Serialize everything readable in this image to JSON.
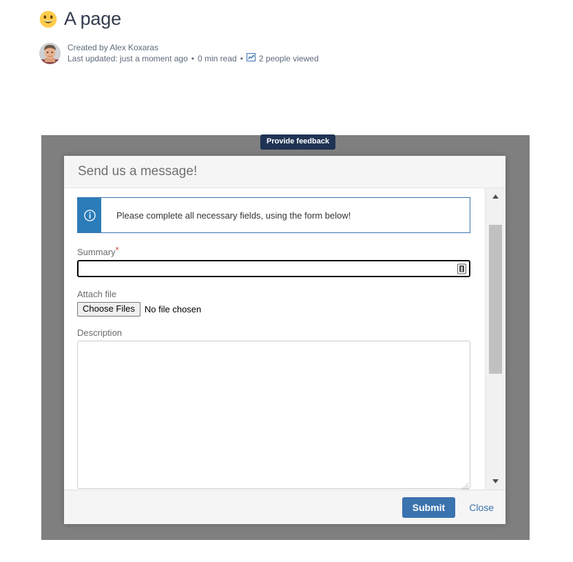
{
  "page": {
    "emoji": "grinning-face",
    "title": "A page",
    "author_line": "Created by Alex Koxaras",
    "meta_updated": "Last updated: just a moment ago",
    "meta_sep1": "•",
    "meta_read": "0 min read",
    "meta_sep2": "•",
    "meta_views": "2 people viewed",
    "views_icon": "line-chart-icon",
    "avatar_alt": "avatar"
  },
  "tooltip": {
    "text": "Provide feedback",
    "bg": "#1f3354"
  },
  "dialog": {
    "title": "Send us a message!",
    "info": {
      "icon": "info-circle-icon",
      "message": "Please complete all necessary fields, using the form below!",
      "accent": "#2b7cb9",
      "border": "#3b73af"
    },
    "fields": {
      "summary": {
        "label": "Summary",
        "required_mark": "*",
        "value": "",
        "placeholder": "",
        "inline_icon": "password-manager-icon"
      },
      "attach": {
        "label": "Attach file",
        "button_label": "Choose Files",
        "status": "No file chosen"
      },
      "description": {
        "label": "Description",
        "value": "",
        "placeholder": ""
      }
    },
    "toolbar_icons": [
      "insert-image-icon",
      "help-circle-icon"
    ],
    "scrollbar": {
      "up_arrow": "▲",
      "down_arrow": "▼"
    },
    "footer": {
      "submit_label": "Submit",
      "close_label": "Close",
      "submit_color": "#3b73af"
    }
  },
  "colors": {
    "overlay": "#7f7f7f",
    "header_bg": "#f5f5f5",
    "label": "#6b6b6b",
    "title": "#333c4e",
    "link": "#3b73af",
    "required": "#d04437"
  }
}
